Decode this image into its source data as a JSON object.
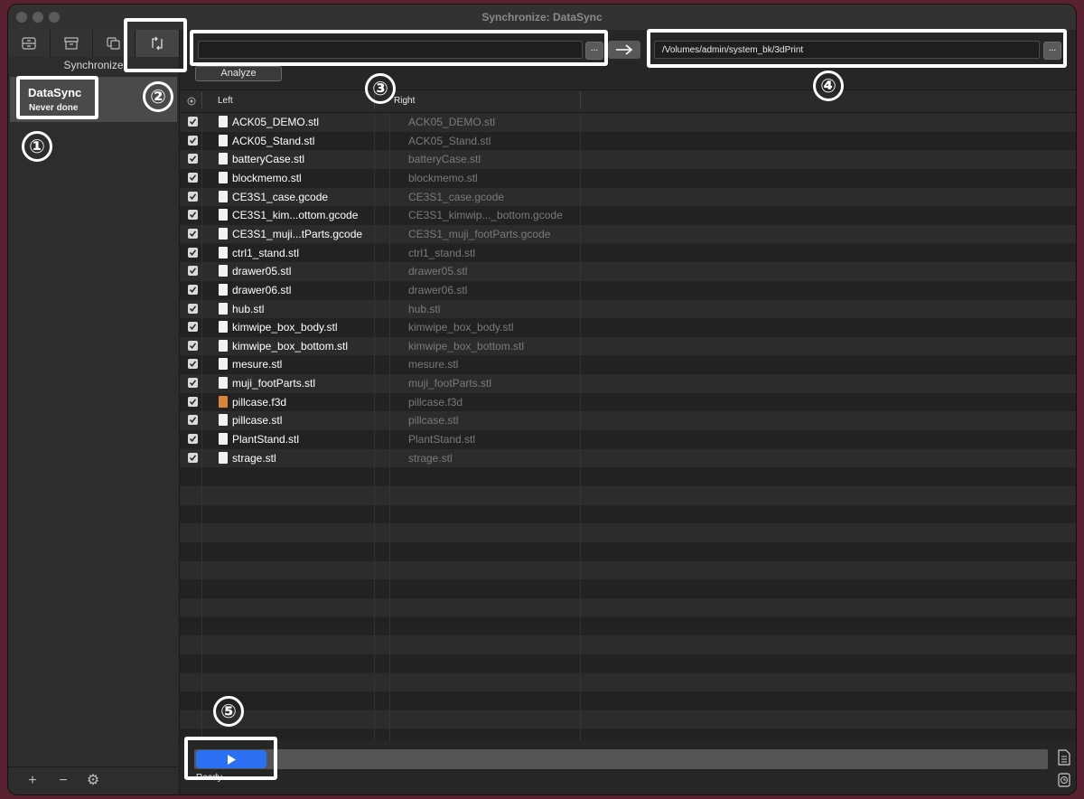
{
  "window": {
    "title": "Synchronize: DataSync"
  },
  "sidebar": {
    "tabs": [
      {
        "icon": "list-icon"
      },
      {
        "icon": "archive-icon"
      },
      {
        "icon": "copy-icon"
      },
      {
        "icon": "sync-icon",
        "active": true
      }
    ],
    "label": "Synchronize",
    "items": [
      {
        "name": "DataSync",
        "status": "Never done"
      }
    ],
    "footer": {
      "add": "+",
      "remove": "−",
      "settings": "⚙"
    }
  },
  "source": {
    "path": "",
    "browse_label": "..."
  },
  "destination": {
    "path": "/Volumes/admin/system_bk/3dPrint",
    "browse_label": "..."
  },
  "analyze_label": "Analyze",
  "table": {
    "headers": {
      "left": "Left",
      "right": "Right"
    },
    "rows": [
      {
        "left": "ACK05_DEMO.stl",
        "right": "ACK05_DEMO.stl",
        "checked": true,
        "type": "stl"
      },
      {
        "left": "ACK05_Stand.stl",
        "right": "ACK05_Stand.stl",
        "checked": true,
        "type": "stl"
      },
      {
        "left": "batteryCase.stl",
        "right": "batteryCase.stl",
        "checked": true,
        "type": "stl"
      },
      {
        "left": "blockmemo.stl",
        "right": "blockmemo.stl",
        "checked": true,
        "type": "stl"
      },
      {
        "left": "CE3S1_case.gcode",
        "right": "CE3S1_case.gcode",
        "checked": true,
        "type": "gcode"
      },
      {
        "left": "CE3S1_kim...ottom.gcode",
        "right": "CE3S1_kimwip..._bottom.gcode",
        "checked": true,
        "type": "gcode"
      },
      {
        "left": "CE3S1_muji...tParts.gcode",
        "right": "CE3S1_muji_footParts.gcode",
        "checked": true,
        "type": "gcode"
      },
      {
        "left": "ctrl1_stand.stl",
        "right": "ctrl1_stand.stl",
        "checked": true,
        "type": "stl"
      },
      {
        "left": "drawer05.stl",
        "right": "drawer05.stl",
        "checked": true,
        "type": "stl"
      },
      {
        "left": "drawer06.stl",
        "right": "drawer06.stl",
        "checked": true,
        "type": "stl"
      },
      {
        "left": "hub.stl",
        "right": "hub.stl",
        "checked": true,
        "type": "stl"
      },
      {
        "left": "kimwipe_box_body.stl",
        "right": "kimwipe_box_body.stl",
        "checked": true,
        "type": "stl"
      },
      {
        "left": "kimwipe_box_bottom.stl",
        "right": "kimwipe_box_bottom.stl",
        "checked": true,
        "type": "stl"
      },
      {
        "left": "mesure.stl",
        "right": "mesure.stl",
        "checked": true,
        "type": "stl"
      },
      {
        "left": "muji_footParts.stl",
        "right": "muji_footParts.stl",
        "checked": true,
        "type": "stl"
      },
      {
        "left": "pillcase.f3d",
        "right": "pillcase.f3d",
        "checked": true,
        "type": "f3d"
      },
      {
        "left": "pillcase.stl",
        "right": "pillcase.stl",
        "checked": true,
        "type": "stl"
      },
      {
        "left": "PlantStand.stl",
        "right": "PlantStand.stl",
        "checked": true,
        "type": "stl"
      },
      {
        "left": "strage.stl",
        "right": "strage.stl",
        "checked": true,
        "type": "stl"
      }
    ]
  },
  "status": {
    "text": "Ready"
  },
  "annotations": [
    "①",
    "②",
    "③",
    "④",
    "⑤"
  ]
}
